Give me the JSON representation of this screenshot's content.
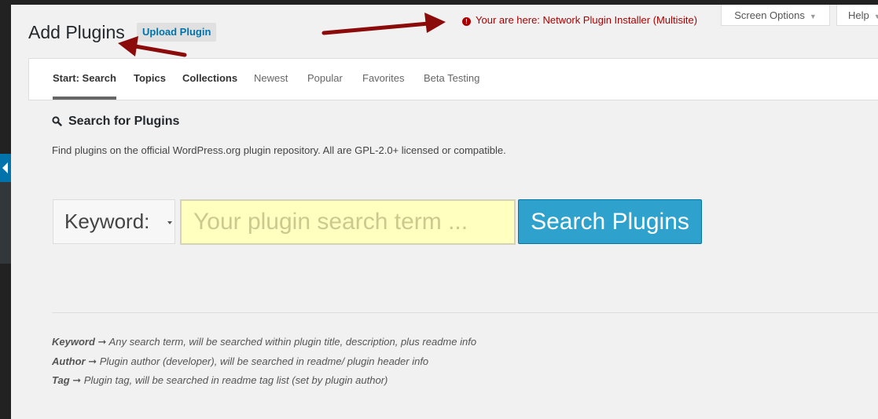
{
  "header": {
    "title": "Add Plugins",
    "upload_label": "Upload Plugin",
    "notice": "Your are here: Network Plugin Installer (Multisite)",
    "screen_options_label": "Screen Options",
    "help_label": "Help"
  },
  "filters": [
    {
      "label": "Start: Search",
      "state": "current"
    },
    {
      "label": "Topics",
      "state": "bold"
    },
    {
      "label": "Collections",
      "state": "bold"
    },
    {
      "label": "Newest",
      "state": "normal"
    },
    {
      "label": "Popular",
      "state": "normal"
    },
    {
      "label": "Favorites",
      "state": "normal"
    },
    {
      "label": "Beta Testing",
      "state": "normal"
    }
  ],
  "search": {
    "heading": "Search for Plugins",
    "description": "Find plugins on the official WordPress.org plugin repository. All are GPL-2.0+ licensed or compatible.",
    "type_selected": "Keyword:",
    "placeholder": "Your plugin search term ...",
    "button_label": "Search Plugins"
  },
  "help": [
    {
      "term": "Keyword",
      "text": "➞ Any search term, will be searched within plugin title, description, plus readme info"
    },
    {
      "term": "Author",
      "text": "➞ Plugin author (developer), will be searched in readme/ plugin header info"
    },
    {
      "term": "Tag",
      "text": "➞ Plugin tag, will be searched in readme tag list (set by plugin author)"
    }
  ],
  "icons": {
    "notice": "alert-circle-icon",
    "search": "magnifier-icon",
    "collapse": "collapse-menu-icon",
    "annotation": "red-arrow-icon"
  },
  "colors": {
    "accent": "#0073aa",
    "button": "#2ea2cc",
    "notice": "#aa0000",
    "annotation_arrow": "#8b0a0a",
    "input_bg": "#ffffc0"
  }
}
